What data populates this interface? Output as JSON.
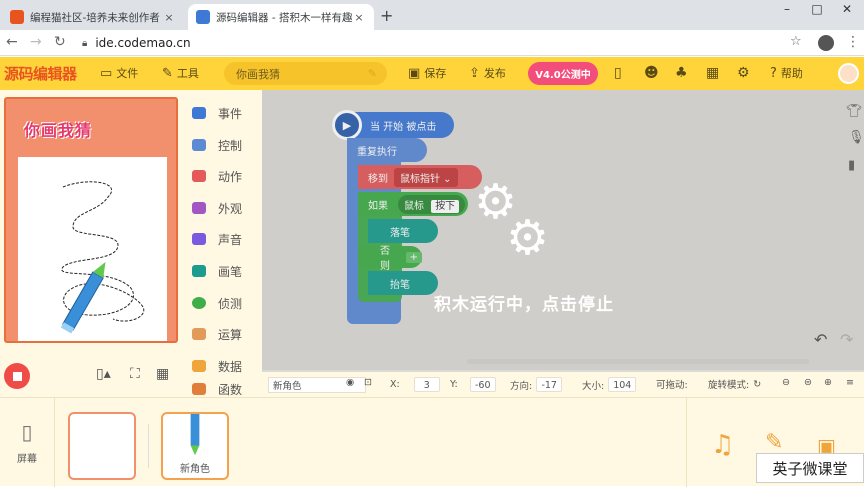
{
  "browser": {
    "tabs": [
      {
        "title": "编程猫社区-培养未来创作者 - 官",
        "close": "×"
      },
      {
        "title": "源码编辑器 - 搭积木一样有趣的",
        "close": "×"
      }
    ],
    "new_tab": "+",
    "window_controls": [
      "–",
      "□",
      "✕"
    ],
    "url": "ide.codemao.cn"
  },
  "appbar": {
    "logo": "源码编辑器",
    "file": "文件",
    "tools": "工具",
    "project_name": "你画我猜",
    "save": "保存",
    "publish": "发布",
    "version_button": "V4.0公测中",
    "help": "帮助"
  },
  "stage": {
    "title": "你画我猜"
  },
  "categories": [
    {
      "label": "事件",
      "color": "#3f79d6"
    },
    {
      "label": "控制",
      "color": "#5c8bd6"
    },
    {
      "label": "动作",
      "color": "#e45a5a"
    },
    {
      "label": "外观",
      "color": "#a257c5"
    },
    {
      "label": "声音",
      "color": "#7a5be0"
    },
    {
      "label": "画笔",
      "color": "#1c9c8f"
    },
    {
      "label": "侦测",
      "color": "#3fae49"
    },
    {
      "label": "运算",
      "color": "#e29a5a"
    },
    {
      "label": "数据",
      "color": "#f0a53c"
    },
    {
      "label": "函数",
      "color": "#e07f3a"
    }
  ],
  "blocks": {
    "when_start": "当 开始 被点击",
    "repeat_forever": "重复执行",
    "move_to": "移到",
    "mouse_pointer": "鼠标指针",
    "if": "如果",
    "mouse": "鼠标",
    "pressed": "按下",
    "pen_down": "落笔",
    "else": "否则",
    "pen_up": "抬笔"
  },
  "overlay_message": "积木运行中，点击停止",
  "statusbar": {
    "sprite_name": "新角色",
    "x_label": "X:",
    "x_value": "3",
    "y_label": "Y:",
    "y_value": "-60",
    "direction_label": "方向:",
    "direction_value": "-17",
    "size_label": "大小:",
    "size_value": "104",
    "draggable_label": "可拖动:",
    "rotation_label": "旋转模式:"
  },
  "bottom": {
    "screen_label": "屏幕",
    "sprite_label": "新角色"
  },
  "watermark": "英子微课堂"
}
